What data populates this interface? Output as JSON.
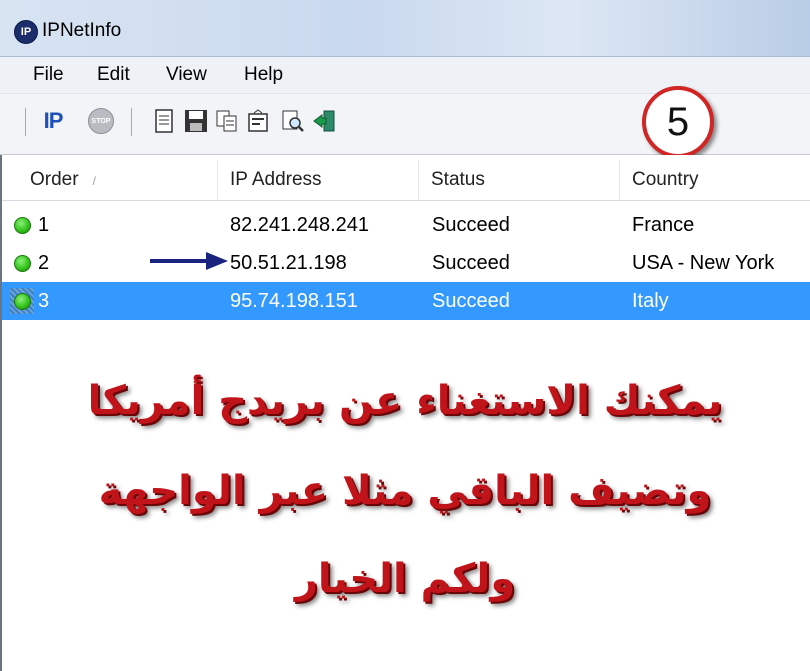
{
  "window": {
    "title": "IPNetInfo",
    "app_icon_text": "IP"
  },
  "menu": [
    "File",
    "Edit",
    "View",
    "Help"
  ],
  "toolbar": {
    "ip_label": "IP",
    "stop_label": "STOP",
    "icons": [
      "ip-lookup-icon",
      "stop-icon",
      "report-icon",
      "save-icon",
      "copy-icon",
      "properties-icon",
      "find-icon",
      "exit-icon"
    ]
  },
  "callout": {
    "label": "5"
  },
  "columns": [
    "Order",
    "IP Address",
    "Status",
    "Country"
  ],
  "rows": [
    {
      "order": "1",
      "ip": "82.241.248.241",
      "status": "Succeed",
      "country": "France",
      "selected": false
    },
    {
      "order": "2",
      "ip": "50.51.21.198",
      "status": "Succeed",
      "country": "USA - New York",
      "selected": false
    },
    {
      "order": "3",
      "ip": "95.74.198.151",
      "status": "Succeed",
      "country": "Italy",
      "selected": true
    }
  ],
  "overlay_text": {
    "line1": "يمكنك الاستغناء عن بريدج أمريكا",
    "line2": "وتضيف الباقي مثلا عبر الواجهة",
    "line3": "ولكم الخيار"
  },
  "colors": {
    "selection": "#3399ff",
    "overlay_text": "#c0141a",
    "callout_border": "#d02626",
    "arrow": "#1a237e",
    "status_dot": "#34c41c"
  }
}
